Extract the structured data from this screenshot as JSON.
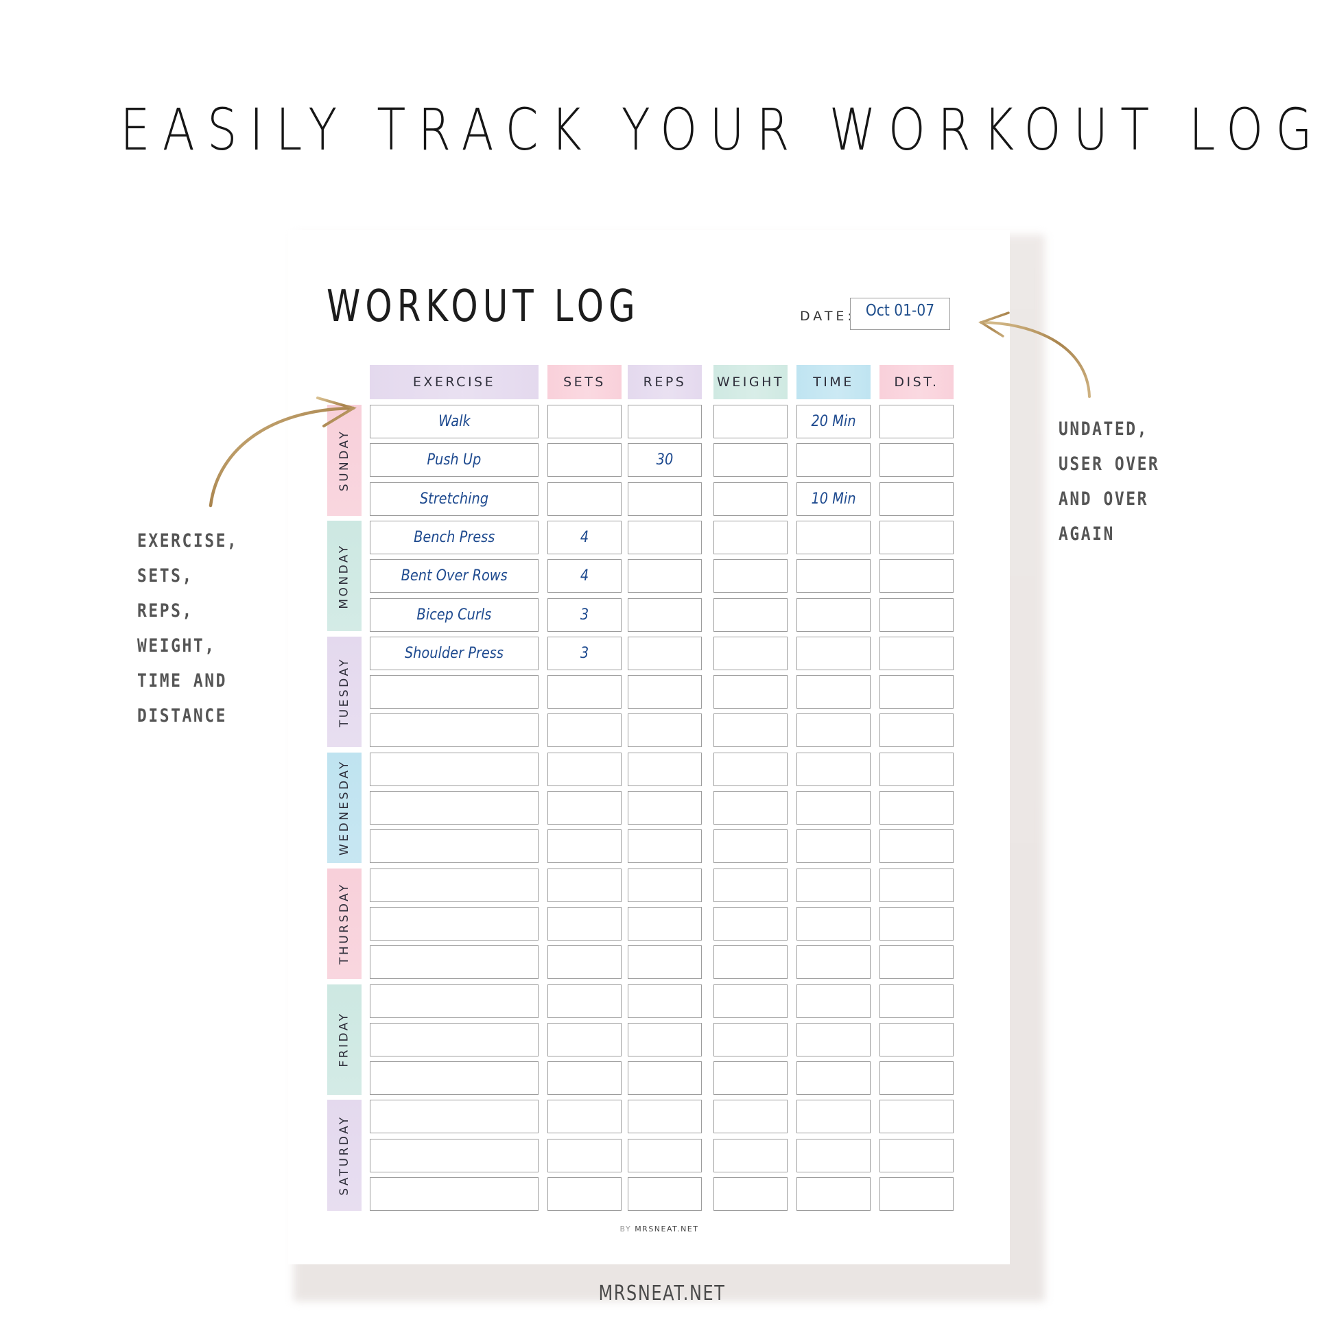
{
  "main_title": "EASILY TRACK YOUR WORKOUT LOG",
  "sheet": {
    "title": "WORKOUT LOG",
    "date_label": "DATE:",
    "date_value": "Oct 01-07",
    "columns": [
      "EXERCISE",
      "SETS",
      "REPS",
      "WEIGHT",
      "TIME",
      "DIST."
    ],
    "column_colors": [
      "#e4d9ee",
      "#f9d0da",
      "#e4d9ee",
      "#cfe9e2",
      "#bfe4f1",
      "#f9d0da"
    ],
    "days": [
      {
        "label": "SUNDAY",
        "color": "#f8d0da"
      },
      {
        "label": "MONDAY",
        "color": "#cde8e2"
      },
      {
        "label": "TUESDAY",
        "color": "#e4d9ee"
      },
      {
        "label": "WEDNESDAY",
        "color": "#bfe3f0"
      },
      {
        "label": "THURSDAY",
        "color": "#f8d0da"
      },
      {
        "label": "FRIDAY",
        "color": "#cde8e2"
      },
      {
        "label": "SATURDAY",
        "color": "#e4d9ee"
      }
    ],
    "rows": [
      [
        "Walk",
        "",
        "",
        "",
        "20 Min",
        ""
      ],
      [
        "Push Up",
        "",
        "30",
        "",
        "",
        ""
      ],
      [
        "Stretching",
        "",
        "",
        "",
        "10 Min",
        ""
      ],
      [
        "Bench Press",
        "4",
        "",
        "",
        "",
        ""
      ],
      [
        "Bent Over Rows",
        "4",
        "",
        "",
        "",
        ""
      ],
      [
        "Bicep Curls",
        "3",
        "",
        "",
        "",
        ""
      ],
      [
        "Shoulder Press",
        "3",
        "",
        "",
        "",
        ""
      ],
      [
        "",
        "",
        "",
        "",
        "",
        ""
      ],
      [
        "",
        "",
        "",
        "",
        "",
        ""
      ],
      [
        "",
        "",
        "",
        "",
        "",
        ""
      ],
      [
        "",
        "",
        "",
        "",
        "",
        ""
      ],
      [
        "",
        "",
        "",
        "",
        "",
        ""
      ],
      [
        "",
        "",
        "",
        "",
        "",
        ""
      ],
      [
        "",
        "",
        "",
        "",
        "",
        ""
      ],
      [
        "",
        "",
        "",
        "",
        "",
        ""
      ],
      [
        "",
        "",
        "",
        "",
        "",
        ""
      ],
      [
        "",
        "",
        "",
        "",
        "",
        ""
      ],
      [
        "",
        "",
        "",
        "",
        "",
        ""
      ],
      [
        "",
        "",
        "",
        "",
        "",
        ""
      ],
      [
        "",
        "",
        "",
        "",
        "",
        ""
      ],
      [
        "",
        "",
        "",
        "",
        "",
        ""
      ]
    ],
    "footer_by": "BY",
    "footer_site": "MRSNEAT.NET"
  },
  "left_note": [
    "EXERCISE,",
    "SETS,",
    "REPS,",
    "WEIGHT,",
    "TIME AND",
    "DISTANCE"
  ],
  "right_note": [
    "UNDATED,",
    "USER OVER",
    "AND OVER",
    "AGAIN"
  ],
  "brand": "MRSNEAT.NET",
  "icons": {
    "left_arrow": "curved-arrow-right-icon",
    "right_arrow": "curved-arrow-left-icon"
  },
  "accent_gold": "#b8965f"
}
